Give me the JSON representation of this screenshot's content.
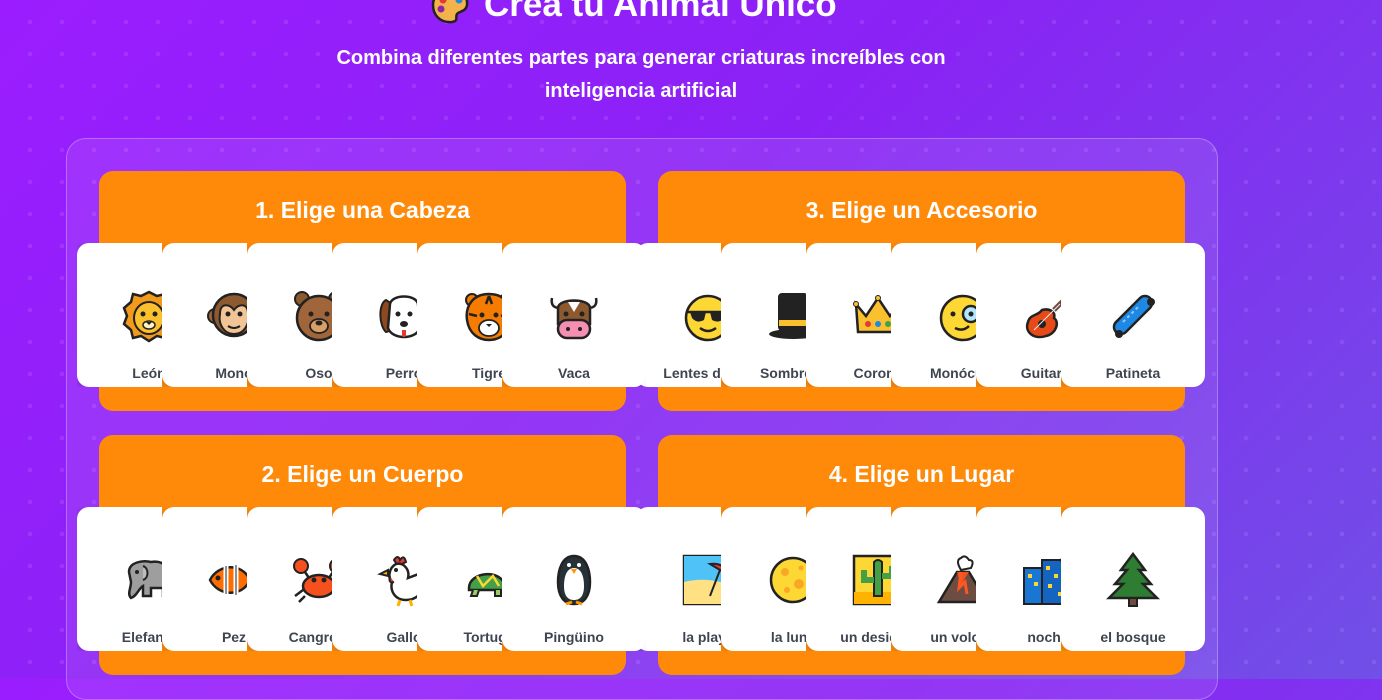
{
  "header": {
    "title": "Crea tu Animal Único",
    "subtitle": "Combina diferentes partes para generar criaturas increíbles con inteligencia artificial"
  },
  "sections": [
    {
      "title": "1. Elige una Cabeza",
      "options": [
        {
          "label": "León",
          "icon": "lion-face-icon"
        },
        {
          "label": "Mono",
          "icon": "monkey-face-icon"
        },
        {
          "label": "Oso",
          "icon": "bear-face-icon"
        },
        {
          "label": "Perro",
          "icon": "dog-face-icon"
        },
        {
          "label": "Tigre",
          "icon": "tiger-face-icon"
        },
        {
          "label": "Vaca",
          "icon": "cow-face-icon"
        }
      ]
    },
    {
      "title": "2. Elige un Cuerpo",
      "options": [
        {
          "label": "Elefante",
          "icon": "elephant-icon"
        },
        {
          "label": "Pez",
          "icon": "tropical-fish-icon"
        },
        {
          "label": "Cangrejo",
          "icon": "crab-icon"
        },
        {
          "label": "Gallo",
          "icon": "rooster-icon"
        },
        {
          "label": "Tortuga",
          "icon": "turtle-icon"
        },
        {
          "label": "Pingüino",
          "icon": "penguin-icon"
        }
      ]
    },
    {
      "title": "3. Elige un Accesorio",
      "options": [
        {
          "label": "Lentes de sol",
          "icon": "sunglasses-face-icon"
        },
        {
          "label": "Sombrero",
          "icon": "top-hat-icon"
        },
        {
          "label": "Corona",
          "icon": "crown-icon"
        },
        {
          "label": "Monóculo",
          "icon": "monocle-face-icon"
        },
        {
          "label": "Guitarra",
          "icon": "guitar-icon"
        },
        {
          "label": "Patineta",
          "icon": "skateboard-icon"
        }
      ]
    },
    {
      "title": "4. Elige un Lugar",
      "options": [
        {
          "label": "la playa",
          "icon": "beach-umbrella-icon"
        },
        {
          "label": "la luna",
          "icon": "full-moon-icon"
        },
        {
          "label": "un desierto",
          "icon": "desert-cactus-icon"
        },
        {
          "label": "un volcán",
          "icon": "volcano-icon"
        },
        {
          "label": "noche",
          "icon": "night-city-icon"
        },
        {
          "label": "el bosque",
          "icon": "evergreen-tree-icon"
        }
      ]
    }
  ],
  "colors": {
    "accent": "#ff8a0a",
    "background": "#8a22f5",
    "card": "#ffffff",
    "label": "#3f4550"
  }
}
